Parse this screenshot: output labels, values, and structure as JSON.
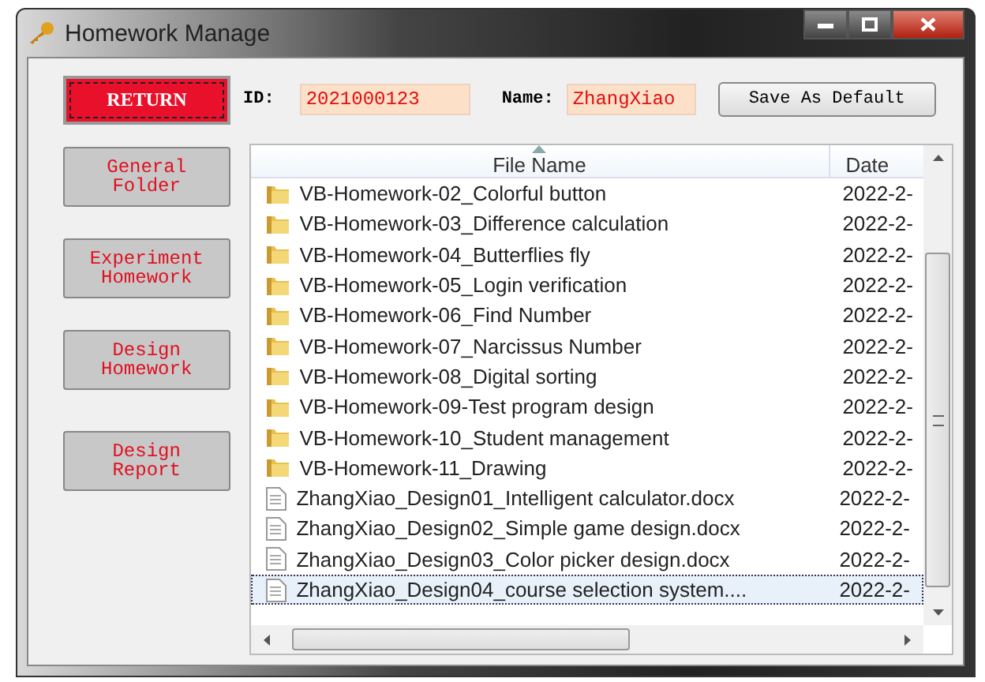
{
  "window": {
    "title": "Homework Manage"
  },
  "return_button": {
    "label": "RETURN"
  },
  "id_field": {
    "label": "ID:",
    "value": "2021000123"
  },
  "name_field": {
    "label": "Name:",
    "value": "ZhangXiao"
  },
  "save_button": {
    "label": "Save As Default"
  },
  "nav_buttons": [
    {
      "label": "General\nFolder"
    },
    {
      "label": "Experiment\nHomework"
    },
    {
      "label": "Design\nHomework"
    },
    {
      "label": "Design\nReport"
    }
  ],
  "file_list": {
    "columns": [
      "File Name",
      "Date"
    ],
    "rows": [
      {
        "kind": "folder",
        "name": "VB-Homework-02_Colorful button",
        "date": "2022-2-",
        "selected": false
      },
      {
        "kind": "folder",
        "name": "VB-Homework-03_Difference calculation",
        "date": "2022-2-",
        "selected": false
      },
      {
        "kind": "folder",
        "name": "VB-Homework-04_Butterflies fly",
        "date": "2022-2-",
        "selected": false
      },
      {
        "kind": "folder",
        "name": "VB-Homework-05_Login verification",
        "date": "2022-2-",
        "selected": false
      },
      {
        "kind": "folder",
        "name": "VB-Homework-06_Find Number",
        "date": "2022-2-",
        "selected": false
      },
      {
        "kind": "folder",
        "name": "VB-Homework-07_Narcissus Number",
        "date": "2022-2-",
        "selected": false
      },
      {
        "kind": "folder",
        "name": "VB-Homework-08_Digital sorting",
        "date": "2022-2-",
        "selected": false
      },
      {
        "kind": "folder",
        "name": "VB-Homework-09-Test program design",
        "date": "2022-2-",
        "selected": false
      },
      {
        "kind": "folder",
        "name": "VB-Homework-10_Student management",
        "date": "2022-2-",
        "selected": false
      },
      {
        "kind": "folder",
        "name": "VB-Homework-11_Drawing",
        "date": "2022-2-",
        "selected": false
      },
      {
        "kind": "document",
        "name": "ZhangXiao_Design01_Intelligent calculator.docx",
        "date": "2022-2-",
        "selected": false
      },
      {
        "kind": "document",
        "name": "ZhangXiao_Design02_Simple game design.docx",
        "date": "2022-2-",
        "selected": false
      },
      {
        "kind": "document",
        "name": "ZhangXiao_Design03_Color picker design.docx",
        "date": "2022-2-",
        "selected": false
      },
      {
        "kind": "document",
        "name": "ZhangXiao_Design04_course selection system....",
        "date": "2022-2-",
        "selected": true
      }
    ]
  }
}
